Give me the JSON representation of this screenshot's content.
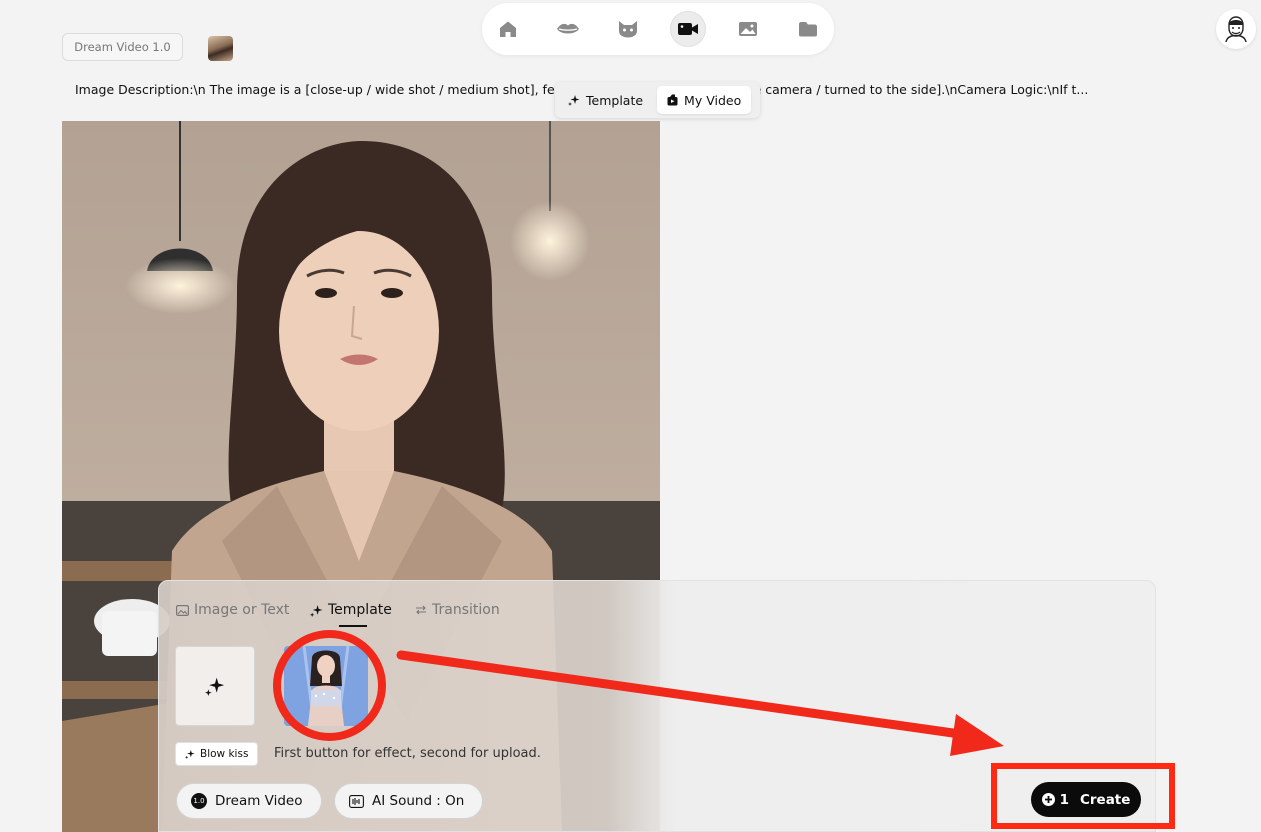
{
  "header": {
    "model_chip": "Dream Video 1.0",
    "nav_items": [
      {
        "icon": "home-icon"
      },
      {
        "icon": "lips-icon"
      },
      {
        "icon": "cat-icon"
      },
      {
        "icon": "video-camera-icon",
        "active": true
      },
      {
        "icon": "image-icon"
      },
      {
        "icon": "folder-icon"
      }
    ],
    "profile_icon": "user-avatar-icon"
  },
  "description": "Image Description:\\n The image is a [close-up / wide shot / medium shot], featuring the subject(s) [facing the camera / turned to the side].\\nCamera Logic:\\nIf t...",
  "mode_toggle": {
    "options": [
      "Template",
      "My Video"
    ],
    "selected": "My Video"
  },
  "panel": {
    "tabs": [
      {
        "label": "Image or Text",
        "icon": "image-icon",
        "active": false
      },
      {
        "label": "Template",
        "icon": "sparkle-icon",
        "active": true
      },
      {
        "label": "Transition",
        "icon": "swap-icon",
        "active": false
      }
    ],
    "effect_chip": "Blow kiss",
    "hint": "First button for effect, second for upload.",
    "model_pill": "Dream Video",
    "model_badge": "1.0",
    "sound_pill": "AI Sound : On",
    "create": {
      "cost": "1",
      "label": "Create"
    }
  },
  "colors": {
    "annotation_red": "#f0291b",
    "create_button": "#0b0b0b"
  }
}
